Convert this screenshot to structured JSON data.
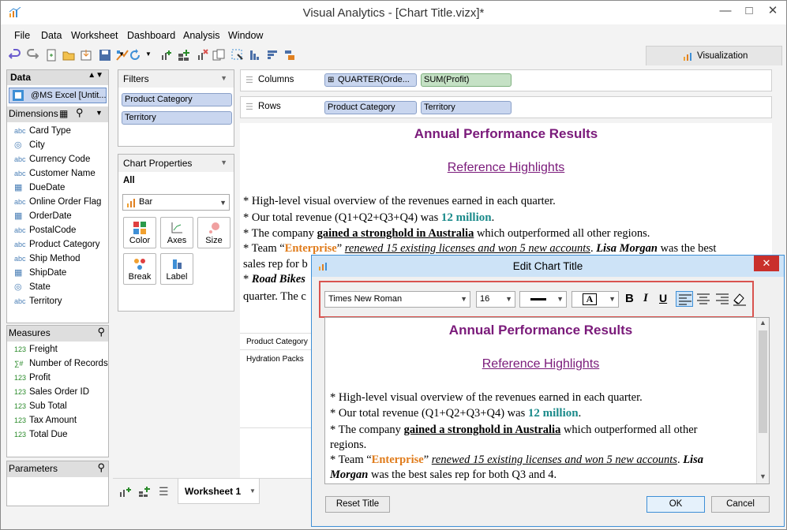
{
  "window": {
    "title": "Visual Analytics - [Chart Title.vizx]*"
  },
  "menu": [
    "File",
    "Data",
    "Worksheet",
    "Dashboard",
    "Analysis",
    "Window"
  ],
  "visualization_tab": "Visualization",
  "data_panel": {
    "header": "Data",
    "source": "@MS Excel [Untit..."
  },
  "dimensions": {
    "header": "Dimensions",
    "items": [
      {
        "type": "abc",
        "label": "Card Type"
      },
      {
        "type": "globe",
        "label": "City"
      },
      {
        "type": "abc",
        "label": "Currency Code"
      },
      {
        "type": "abc",
        "label": "Customer Name"
      },
      {
        "type": "date",
        "label": "DueDate"
      },
      {
        "type": "abc",
        "label": "Online Order Flag"
      },
      {
        "type": "date",
        "label": "OrderDate"
      },
      {
        "type": "abc",
        "label": "PostalCode"
      },
      {
        "type": "abc",
        "label": "Product Category"
      },
      {
        "type": "abc",
        "label": "Ship Method"
      },
      {
        "type": "date",
        "label": "ShipDate"
      },
      {
        "type": "globe",
        "label": "State"
      },
      {
        "type": "abc",
        "label": "Territory"
      }
    ]
  },
  "measures": {
    "header": "Measures",
    "items": [
      {
        "type": "123",
        "label": "Freight"
      },
      {
        "type": "calc",
        "label": "Number of Records"
      },
      {
        "type": "123",
        "label": "Profit"
      },
      {
        "type": "123",
        "label": "Sales Order ID"
      },
      {
        "type": "123",
        "label": "Sub Total"
      },
      {
        "type": "123",
        "label": "Tax Amount"
      },
      {
        "type": "123",
        "label": "Total Due"
      }
    ]
  },
  "parameters": {
    "header": "Parameters"
  },
  "filters": {
    "header": "Filters",
    "items": [
      "Product Category",
      "Territory"
    ]
  },
  "chart_properties": {
    "header": "Chart Properties",
    "scope": "All",
    "mark_type": "Bar",
    "buttons": [
      "Color",
      "Axes",
      "Size",
      "Break",
      "Label"
    ]
  },
  "shelves": {
    "columns_label": "Columns",
    "rows_label": "Rows",
    "columns": [
      "QUARTER(Orde...",
      "SUM(Profit)"
    ],
    "rows": [
      "Product Category",
      "Territory"
    ]
  },
  "chart": {
    "title": "Annual Performance Results",
    "subtitle": "Reference Highlights",
    "lines": {
      "l1": "* High-level visual overview of the revenues earned in each quarter.",
      "l2a": "* Our total revenue (Q1+Q2+Q3+Q4) was ",
      "l2b": "12 million",
      "l2c": ".",
      "l3a": "* The company ",
      "l3b": "gained a stronghold in Australia",
      "l3c": " which outperformed all other regions.",
      "l4a": "* Team “",
      "l4b": "Enterprise",
      "l4c": "” ",
      "l4d": "renewed 15 existing licenses and won 5 new accounts",
      "l4e": ". ",
      "l4f": "Lisa Morgan",
      "l4g": " was the best",
      "l5": "sales rep for b",
      "l6a": "* ",
      "l6b": "Road Bikes",
      "l7": "quarter. The c"
    },
    "header_cell": "Product Category",
    "row_cell": "Hydration Packs"
  },
  "sheet_tab": "Worksheet 1",
  "dialog": {
    "title": "Edit Chart Title",
    "font": "Times New Roman",
    "size": "16",
    "editor": {
      "title": "Annual Performance Results",
      "subtitle": "Reference Highlights",
      "p1": "* High-level visual overview of the revenues earned in each quarter.",
      "p2a": "* Our total revenue (Q1+Q2+Q3+Q4) was ",
      "p2b": "12 million",
      "p2c": ".",
      "p3a": "* The company ",
      "p3b": "gained a stronghold in Australia",
      "p3c": " which outperformed all other",
      "p3d": "regions.",
      "p4a": "* Team “",
      "p4b": "Enterprise",
      "p4c": "” ",
      "p4d": "renewed 15 existing licenses and won 5 new accounts",
      "p4e": ". ",
      "p4f": "Lisa",
      "p5a": "Morgan",
      "p5b": " was the best sales rep for both Q3 and 4."
    },
    "reset_label": "Reset Title",
    "ok_label": "OK",
    "cancel_label": "Cancel"
  },
  "colors": {
    "accent_blue": "#3e8fd6",
    "title_purple": "#7a1a7a",
    "highlight_red": "#d9534f"
  }
}
